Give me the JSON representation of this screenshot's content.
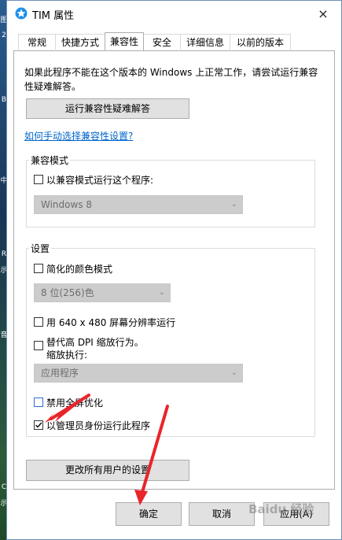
{
  "window": {
    "title": "TIM 属性",
    "close_icon": "×"
  },
  "tabs": [
    {
      "label": "常规",
      "active": false
    },
    {
      "label": "快捷方式",
      "active": false
    },
    {
      "label": "兼容性",
      "active": true
    },
    {
      "label": "安全",
      "active": false
    },
    {
      "label": "详细信息",
      "active": false
    },
    {
      "label": "以前的版本",
      "active": false
    }
  ],
  "intro_text": "如果此程序不能在这个版本的 Windows 上正常工作，请尝试运行兼容性疑难解答。",
  "troubleshoot_button": "运行兼容性疑难解答",
  "manual_link": "如何手动选择兼容性设置?",
  "compat_mode": {
    "title": "兼容模式",
    "checkbox_label": "以兼容模式运行这个程序:",
    "checked": false,
    "select_value": "Windows 8"
  },
  "settings": {
    "title": "设置",
    "reduced_color": {
      "label": "简化的颜色模式",
      "checked": false
    },
    "color_select": "8 位(256)色",
    "res_640": {
      "label": "用 640 x 480 屏幕分辨率运行",
      "checked": false
    },
    "dpi_override": {
      "label_line1": "替代高 DPI 缩放行为。",
      "label_line2": "缩放执行:",
      "checked": false
    },
    "dpi_select": "应用程序",
    "disable_fullscreen": {
      "label": "禁用全屏优化",
      "checked": false
    },
    "run_as_admin": {
      "label": "以管理员身份运行此程序",
      "checked": true
    }
  },
  "all_users_button": "更改所有用户的设置",
  "footer": {
    "ok": "确定",
    "cancel": "取消",
    "apply": "应用(A)"
  },
  "watermark": "Baidu 经验",
  "colors": {
    "accent_link": "#0066cc",
    "arrow": "#e8252b"
  }
}
